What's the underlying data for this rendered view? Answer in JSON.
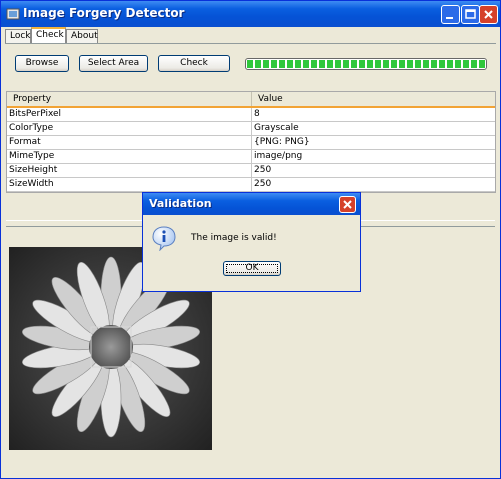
{
  "window": {
    "title": "Image Forgery Detector"
  },
  "tabs": [
    {
      "label": "Lock"
    },
    {
      "label": "Check",
      "active": true
    },
    {
      "label": "About"
    }
  ],
  "toolbar": {
    "browse_label": "Browse",
    "select_area_label": "Select Area",
    "check_label": "Check",
    "progress_percent": 100
  },
  "table": {
    "headers": [
      "Property",
      "Value"
    ],
    "rows": [
      [
        "BitsPerPixel",
        "8"
      ],
      [
        "ColorType",
        "Grayscale"
      ],
      [
        "Format",
        "{PNG: PNG}"
      ],
      [
        "MimeType",
        "image/png"
      ],
      [
        "SizeHeight",
        "250"
      ],
      [
        "SizeWidth",
        "250"
      ]
    ]
  },
  "dialog": {
    "title": "Validation",
    "message": "The image is valid!",
    "ok_label": "OK"
  },
  "colors": {
    "titlebar": "#0553d6",
    "progress": "#2fc73b",
    "close": "#d5412a",
    "header_accent": "#f2a335"
  }
}
